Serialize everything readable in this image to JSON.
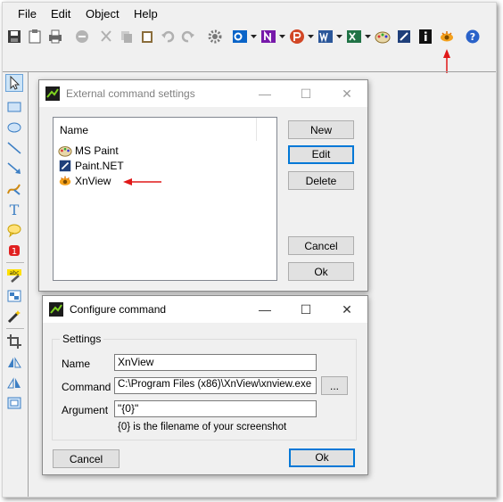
{
  "menu": [
    "File",
    "Edit",
    "Object",
    "Help"
  ],
  "toolbar_icons": [
    "save-icon",
    "paste-icon",
    "print-icon",
    "stop-icon",
    "cut-icon",
    "copy-icon",
    "clipboard-icon",
    "undo-icon",
    "redo-icon",
    "gear-icon",
    "outlook-icon",
    "onenote-icon",
    "powerpoint-icon",
    "word-icon",
    "excel-icon",
    "mspaint-icon",
    "paintnet-icon",
    "info-icon",
    "xnview-icon",
    "help-icon"
  ],
  "colors": {
    "accent": "#0078d7",
    "annotation_arrow": "#e01818",
    "outlook": "#0a64c8",
    "onenote": "#7719aa",
    "powerpoint": "#d24726",
    "word": "#2b579a",
    "excel": "#217346"
  },
  "external_dialog": {
    "title": "External command settings",
    "list_header": "Name",
    "items": [
      "MS Paint",
      "Paint.NET",
      "XnView"
    ],
    "buttons": {
      "new": "New",
      "edit": "Edit",
      "delete": "Delete",
      "cancel": "Cancel",
      "ok": "Ok"
    }
  },
  "configure_dialog": {
    "title": "Configure command",
    "group": "Settings",
    "name_label": "Name",
    "name_value": "XnView",
    "command_label": "Command",
    "command_value": "C:\\Program Files (x86)\\XnView\\xnview.exe",
    "browse": "...",
    "argument_label": "Argument",
    "argument_value": "\"{0}\"",
    "hint": "{0} is the filename of your screenshot",
    "cancel": "Cancel",
    "ok": "Ok"
  },
  "window_controls": {
    "minimize": "—",
    "maximize": "☐",
    "close": "✕"
  }
}
